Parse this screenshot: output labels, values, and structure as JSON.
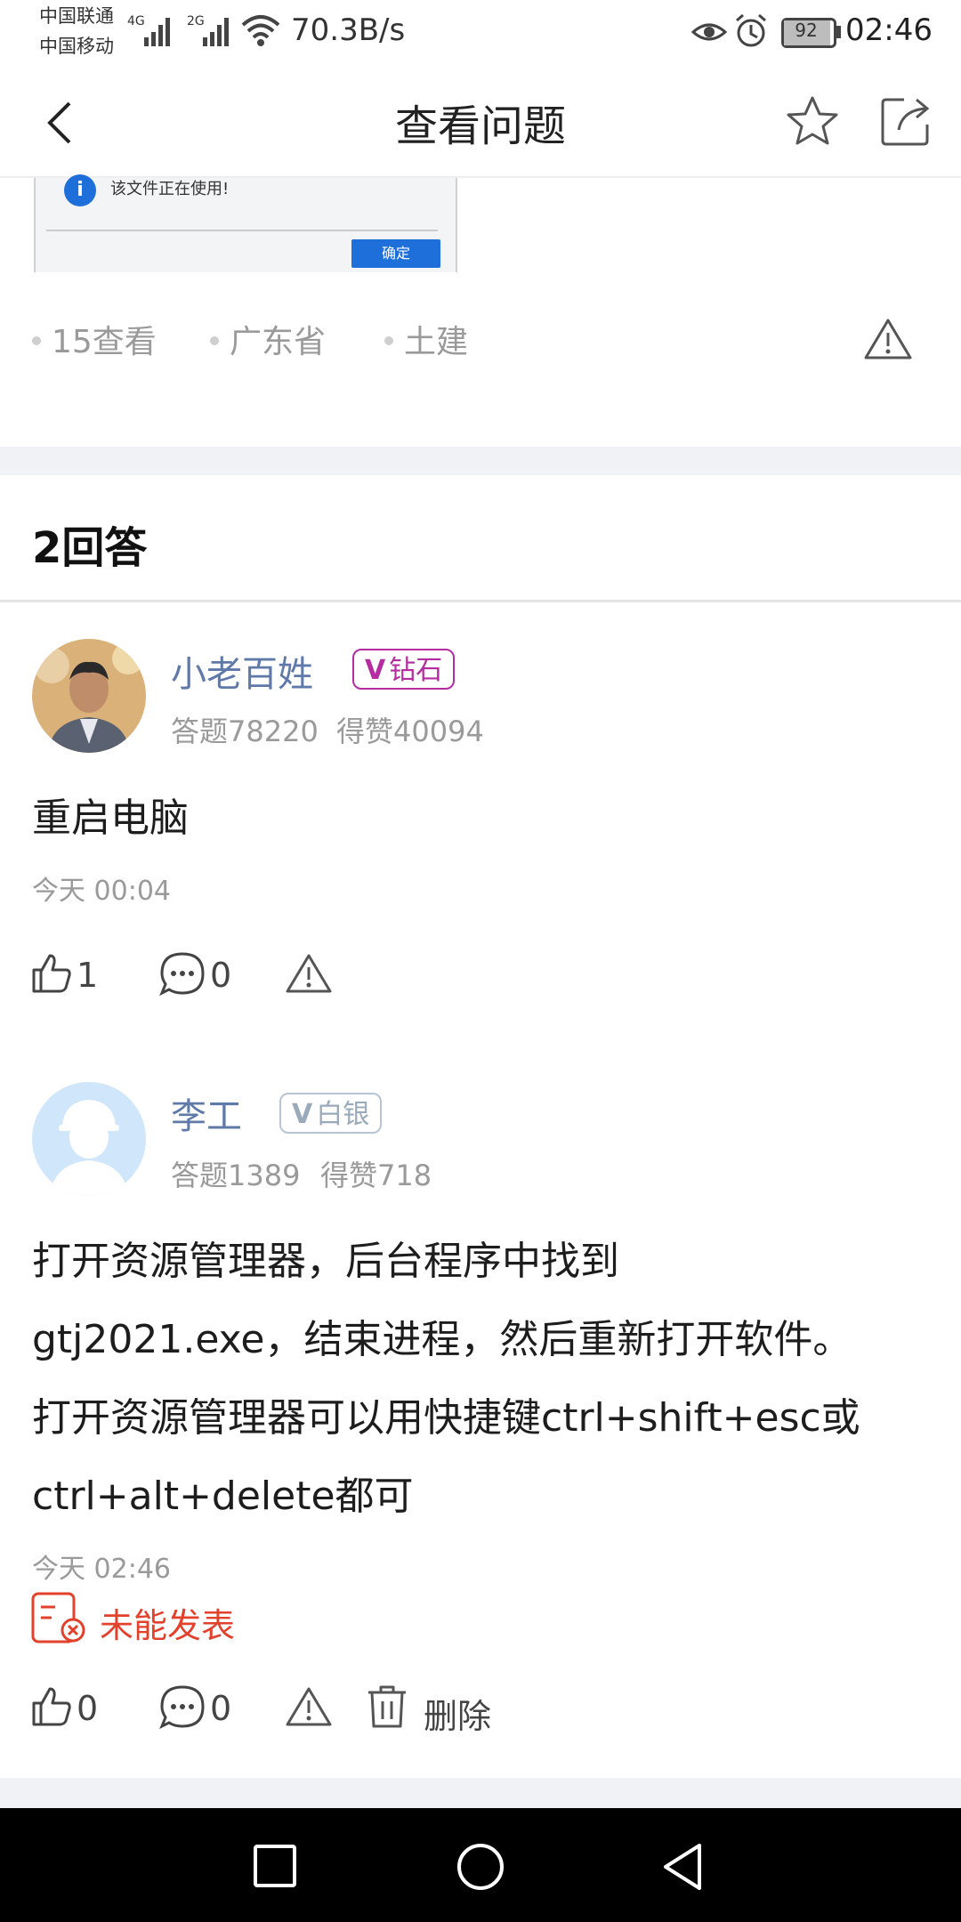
{
  "status_bar": {
    "carrier_1": "中国联通",
    "carrier_2": "中国移动",
    "net_1": "4G",
    "net_2": "2G",
    "speed": "70.3B/s",
    "battery": "92",
    "time": "02:46"
  },
  "header": {
    "title": "查看问题",
    "back_icon": "back-chevron-icon",
    "favorite_icon": "star-icon",
    "share_icon": "share-icon"
  },
  "question_image": {
    "dialog_text": "该文件正在使用!",
    "ok_button": "确定"
  },
  "question_meta": {
    "views": "15查看",
    "region": "广东省",
    "category": "土建",
    "report_icon": "warning-icon"
  },
  "answers_header": "2回答",
  "answers": [
    {
      "author": "小老百姓",
      "badge": "钻石",
      "answers_count": "答题78220",
      "likes_total": "得赞40094",
      "content": "重启电脑",
      "time": "今天 00:04",
      "likes": "1",
      "comments": "0"
    },
    {
      "author": "李工",
      "badge": "白银",
      "answers_count": "答题1389",
      "likes_total": "得赞718",
      "content_lines": [
        "打开资源管理器，后台程序中找到",
        "gtj2021.exe，结束进程，然后重新打开软件。",
        "打开资源管理器可以用快捷键ctrl+shift+esc或",
        "ctrl+alt+delete都可"
      ],
      "time": "今天 02:46",
      "status": "未能发表",
      "likes": "0",
      "comments": "0",
      "delete_label": "删除"
    }
  ],
  "colors": {
    "author_blue": "#5f79a8",
    "diamond_purple": "#b42ca0",
    "silver": "#9aaabb",
    "error_red": "#e2412b",
    "band_gray": "#f1f2f5"
  }
}
